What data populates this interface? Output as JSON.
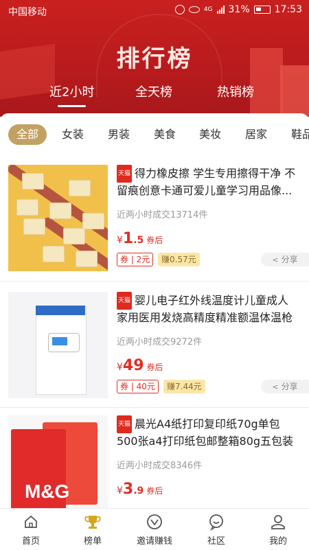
{
  "status_bar": {
    "carrier": "中国移动",
    "signal_label": "4G",
    "battery": "31%",
    "time": "17:53"
  },
  "header": {
    "title": "排行榜",
    "tabs": [
      {
        "label": "近2小时",
        "active": true
      },
      {
        "label": "全天榜",
        "active": false
      },
      {
        "label": "热销榜",
        "active": false
      }
    ]
  },
  "categories": [
    "全部",
    "女装",
    "男装",
    "美食",
    "美妆",
    "居家",
    "鞋品"
  ],
  "products": [
    {
      "platform_badge": "天猫",
      "title": "得力橡皮擦 学生专用擦得干净 不留痕创意卡通可爱儿童学习用品像...",
      "sold": "近两小时成交13714件",
      "price_yen": "¥",
      "price_int": "1",
      "price_dec": ".5",
      "price_suffix": "券后",
      "coupon": "券 | 2元",
      "earn": "赚0.57元",
      "share": "分享"
    },
    {
      "platform_badge": "天猫",
      "title": "婴儿电子红外线温度计儿童成人家用医用发烧高精度精准额温体温枪",
      "sold": "近两小时成交9272件",
      "price_yen": "¥",
      "price_int": "49",
      "price_dec": "",
      "price_suffix": "券后",
      "coupon": "券 | 40元",
      "earn": "赚7.44元",
      "share": "分享"
    },
    {
      "platform_badge": "天猫",
      "title": "晨光A4纸打印复印纸70g单包500张a4打印纸包邮整箱80g五包装a四...",
      "sold": "近两小时成交8346件",
      "price_yen": "¥",
      "price_int": "3",
      "price_dec": ".9",
      "price_suffix": "券后",
      "thumb_text": "M&G"
    }
  ],
  "bottom_nav": [
    {
      "label": "首页",
      "icon": "home-icon"
    },
    {
      "label": "榜单",
      "icon": "trophy-icon",
      "active": true
    },
    {
      "label": "邀请赚钱",
      "icon": "invite-icon"
    },
    {
      "label": "社区",
      "icon": "community-icon"
    },
    {
      "label": "我的",
      "icon": "profile-icon"
    }
  ],
  "colors": {
    "header_red": "#c9201f",
    "price_red": "#e02e24",
    "category_active": "#c2a163",
    "earn_bg": "#fbe6a8",
    "nav_active": "#d6a51f"
  }
}
